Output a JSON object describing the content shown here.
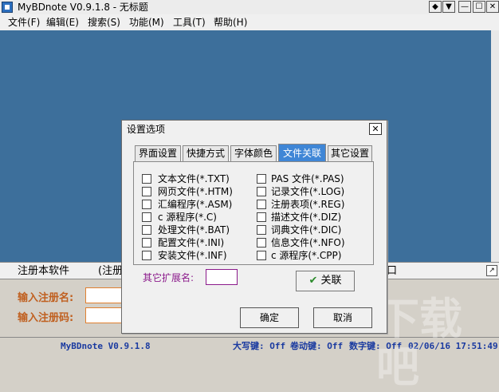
{
  "window": {
    "title": "MyBDnote V0.9.1.8 - 无标题",
    "controls": [
      "◆",
      "▼",
      "—",
      "☐",
      "✕"
    ]
  },
  "menu": [
    "文件(F)",
    "编辑(E)",
    "搜索(S)",
    "功能(M)",
    "工具(T)",
    "帮助(H)"
  ],
  "registration": {
    "bar_label": "注册本软件",
    "bar_label2": "(注册",
    "bar_right": "口",
    "name_label": "输入注册名:",
    "code_label": "输入注册码:",
    "name_value": "",
    "code_value": ""
  },
  "status": {
    "app": "MyBDnote V0.9.1.8",
    "caps": "大写键: Off",
    "scroll": "卷动键: Off",
    "num": "数字键: Off",
    "datetime": "02/06/16 17:51:49"
  },
  "dialog": {
    "title": "设置选项",
    "close": "✕",
    "tabs": [
      "界面设置",
      "快捷方式",
      "字体颜色",
      "文件关联",
      "其它设置"
    ],
    "active_tab": 3,
    "left_items": [
      "文本文件(*.TXT)",
      "网页文件(*.HTM)",
      "汇编程序(*.ASM)",
      "c 源程序(*.C)",
      "处理文件(*.BAT)",
      "配置文件(*.INI)",
      "安装文件(*.INF)"
    ],
    "right_items": [
      "PAS 文件(*.PAS)",
      "记录文件(*.LOG)",
      "注册表项(*.REG)",
      "描述文件(*.DIZ)",
      "词典文件(*.DIC)",
      "信息文件(*.NFO)",
      "c 源程序(*.CPP)"
    ],
    "ext_label": "其它扩展名:",
    "ext_value": "",
    "assoc_button": "关联",
    "ok_button": "确定",
    "cancel_button": "取消"
  },
  "colors": {
    "editor_bg": "#3d6f9b",
    "active_tab": "#3f86d6",
    "status_text": "#1a3aa0"
  }
}
